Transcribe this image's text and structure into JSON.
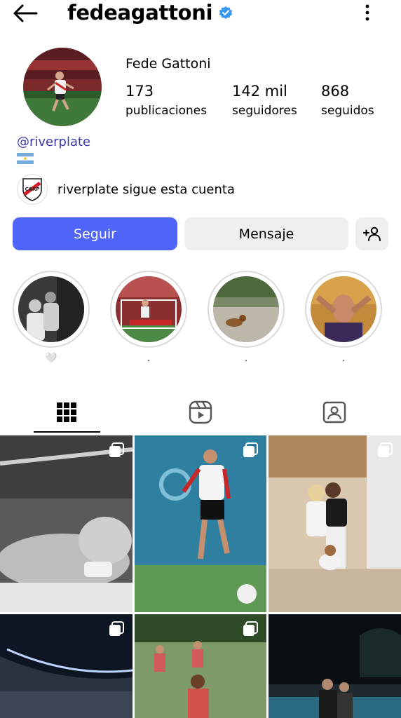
{
  "header": {
    "username": "fedeagattoni",
    "back_icon": "arrow-left-icon",
    "verified_icon": "verified-badge-icon",
    "more_icon": "more-vertical-icon"
  },
  "profile": {
    "full_name": "Fede Gattoni",
    "stats": [
      {
        "value": "173",
        "label": "publicaciones"
      },
      {
        "value": "142 mil",
        "label": "seguidores"
      },
      {
        "value": "868",
        "label": "seguidos"
      }
    ],
    "bio_link_text": "riverplate",
    "bio_link_icon": "threads-icon",
    "flag_icon": "argentina-flag-icon",
    "followed_by_text": "riverplate sigue esta cuenta"
  },
  "actions": {
    "follow_label": "Seguir",
    "message_label": "Mensaje",
    "add_person_icon": "add-person-icon"
  },
  "highlights": [
    {
      "label": "🤍"
    },
    {
      "label": "."
    },
    {
      "label": "."
    },
    {
      "label": "."
    }
  ],
  "tabs": [
    {
      "name": "grid",
      "icon": "grid-icon",
      "active": true
    },
    {
      "name": "reels",
      "icon": "reels-icon",
      "active": false
    },
    {
      "name": "tagged",
      "icon": "tagged-icon",
      "active": false
    }
  ],
  "colors": {
    "accent": "#4f64f9",
    "secondary_button": "#efefef",
    "verified": "#3897f0",
    "link": "#3a3aa8"
  }
}
